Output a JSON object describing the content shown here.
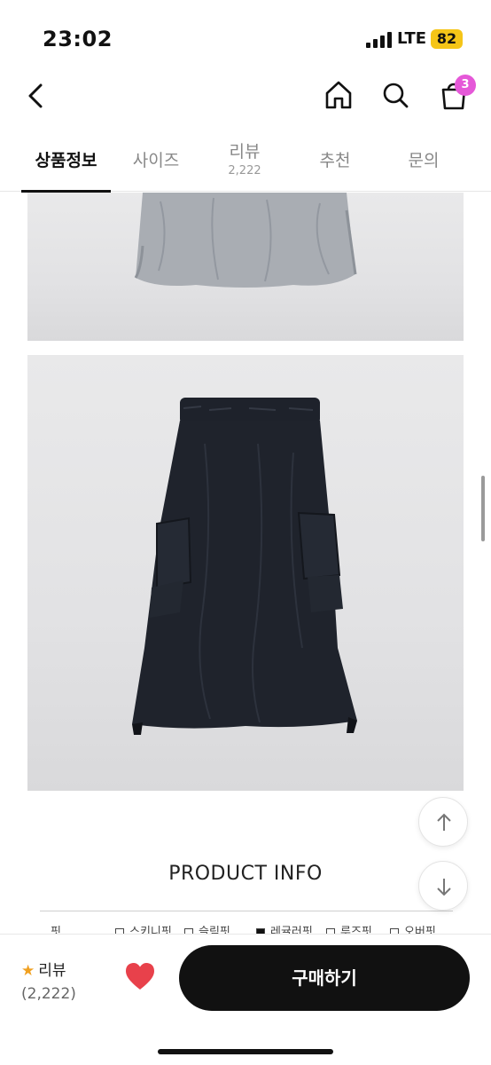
{
  "status": {
    "time": "23:02",
    "network": "LTE",
    "battery": "82"
  },
  "nav": {
    "cart_count": "3"
  },
  "tabs": [
    {
      "label": "상품정보"
    },
    {
      "label": "사이즈"
    },
    {
      "label": "리뷰",
      "sub": "2,222"
    },
    {
      "label": "추천"
    },
    {
      "label": "문의"
    }
  ],
  "content": {
    "section_title": "PRODUCT INFO",
    "fit": {
      "label": "핏",
      "options": [
        "스키니핏",
        "슬림핏",
        "레귤러핏",
        "루즈핏",
        "오버핏"
      ],
      "selected": "레귤러핏"
    }
  },
  "bottom": {
    "review_label": "리뷰",
    "review_count": "(2,222)",
    "buy_label": "구매하기"
  },
  "colors": {
    "accent": "#111111",
    "badge": "#e558d8",
    "heart": "#e8414b",
    "star": "#f0a020",
    "battery": "#f5c518"
  }
}
